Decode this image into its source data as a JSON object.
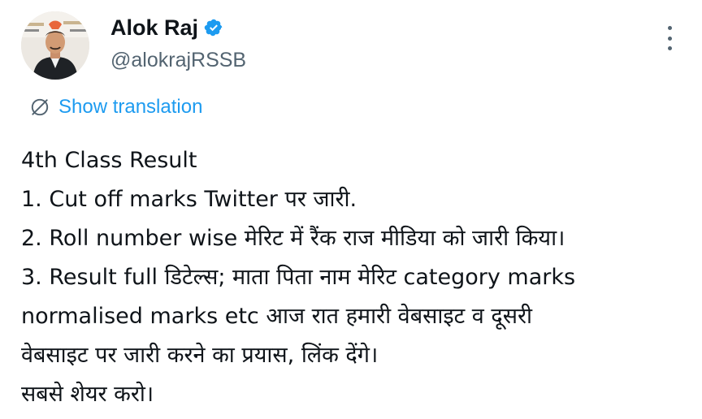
{
  "author": {
    "display_name": "Alok Raj",
    "handle": "@alokrajRSSB",
    "verified_icon": "verified-badge-icon",
    "avatar_icon": "profile-photo"
  },
  "more_menu": {
    "icon": "more-vertical-icon"
  },
  "translation": {
    "label": "Show translation",
    "icon": "translate-globe-icon"
  },
  "tweet": {
    "lines": [
      "4th Class Result",
      "1. Cut off marks Twitter पर जारी.",
      "2. Roll number wise मेरिट में रैंक राज मीडिया को जारी किया।",
      "3. Result full डिटेल्स; माता पिता नाम मेरिट category marks",
      "normalised marks etc आज रात हमारी वेबसाइट व दूसरी",
      "वेबसाइट पर जारी करने का प्रयास, लिंक देंगे।",
      "सबसे शेयर करो।"
    ]
  },
  "colors": {
    "text_primary": "#0f1419",
    "text_secondary": "#536471",
    "link": "#1d9bf0",
    "background": "#ffffff"
  }
}
